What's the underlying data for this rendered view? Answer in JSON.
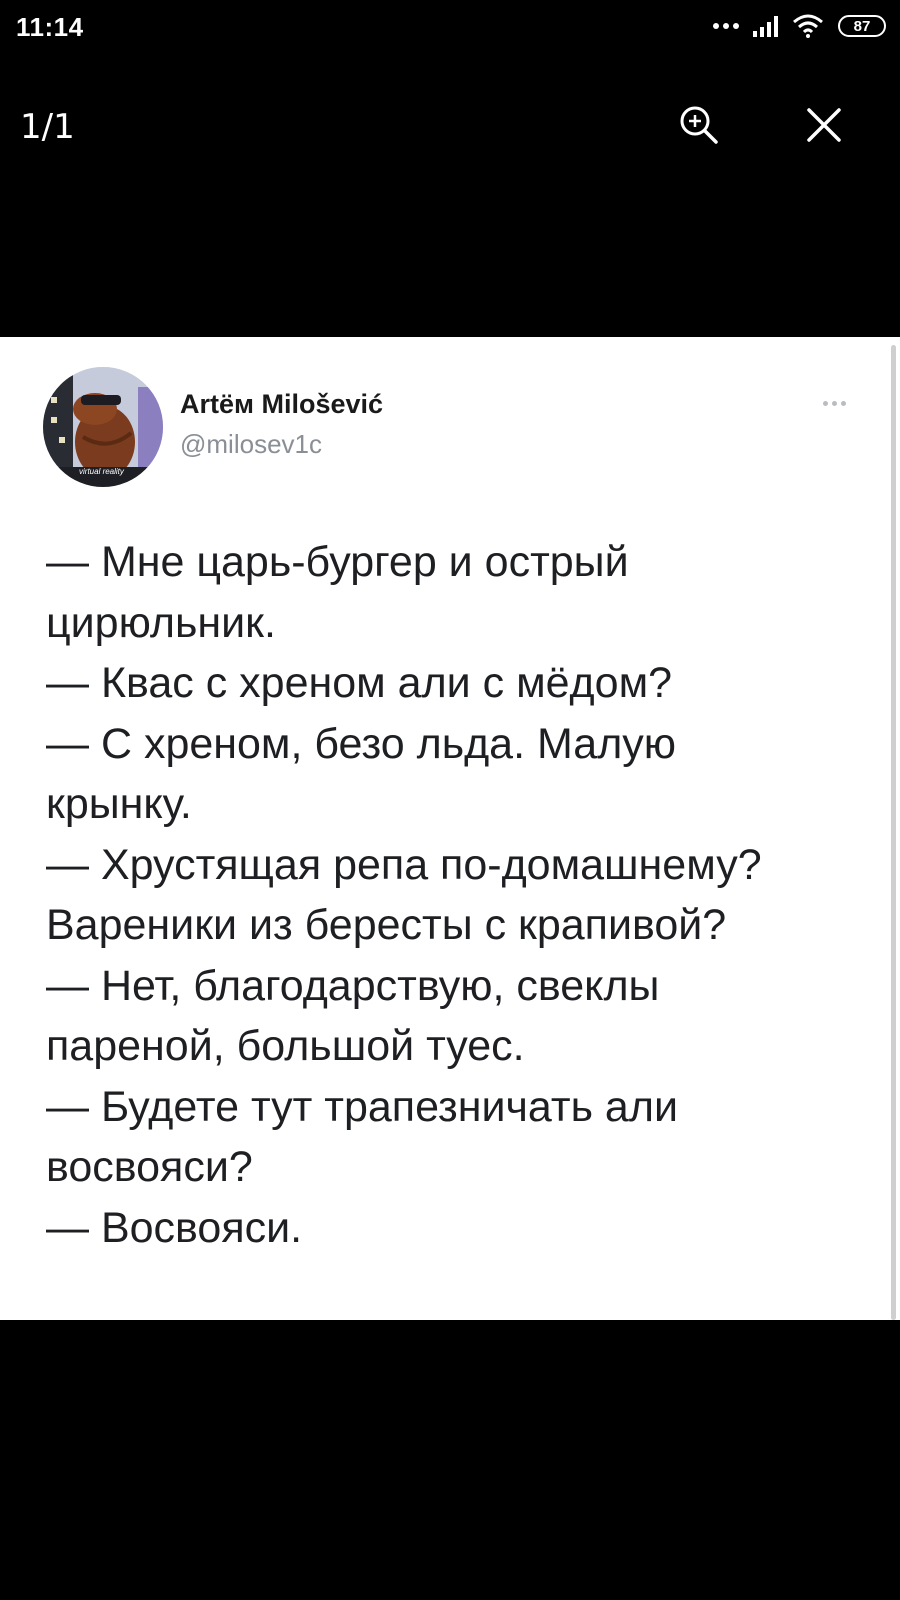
{
  "status_bar": {
    "time": "11:14",
    "battery_level": "87",
    "icons": [
      "signal-dots-icon",
      "cellular-signal-icon",
      "wifi-icon",
      "battery-icon"
    ]
  },
  "viewer": {
    "page_counter": "1/1",
    "zoom_icon": "zoom-in-icon",
    "close_icon": "close-icon"
  },
  "tweet": {
    "author_name": "Artём Milošević",
    "author_handle": "@milosev1c",
    "avatar_caption": "virtual reality",
    "lines": [
      "— Мне царь-бургер и острый",
      "цирюльник.",
      "— Квас с хреном али с мёдом?",
      "— С хреном, безо льда. Малую",
      "крынку.",
      "— Хрустящая репа по-домашнему?",
      "Вареники из бересты с крапивой?",
      "— Нет, благодарствую, свеклы",
      "пареной, большой туес.",
      "— Будете тут трапезничать али",
      "восвояси?",
      "— Восвояси."
    ]
  },
  "colors": {
    "background": "#000000",
    "card": "#ffffff",
    "text": "#1d1f22",
    "handle": "#8a8f96"
  }
}
